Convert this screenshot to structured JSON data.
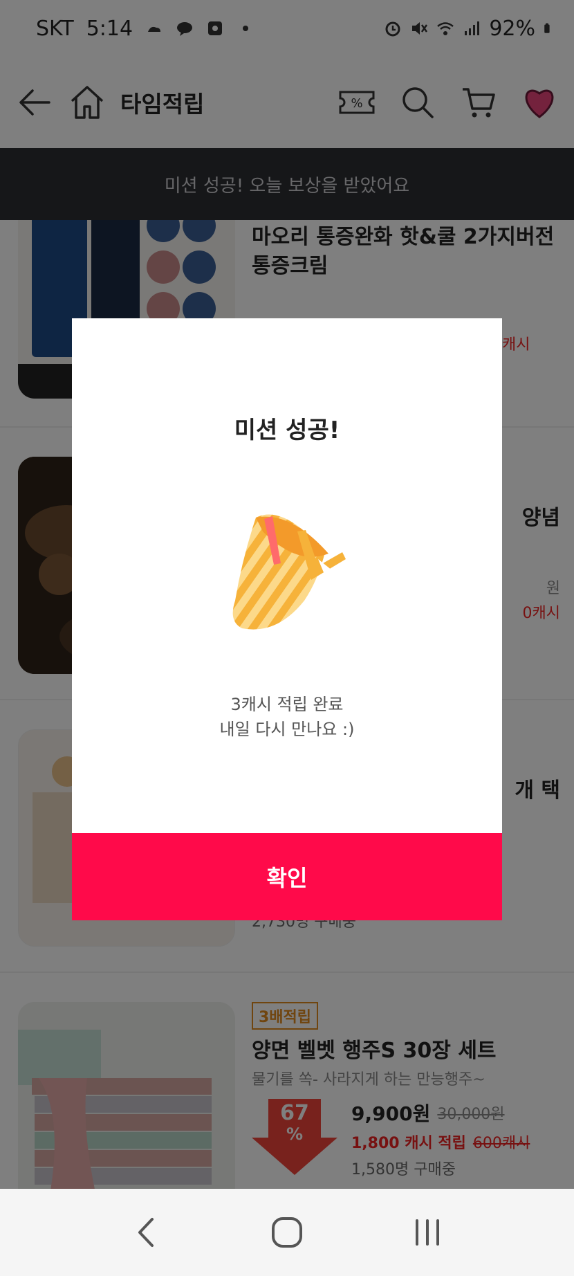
{
  "status_bar": {
    "carrier": "SKT",
    "time": "5:14",
    "battery": "92%"
  },
  "header": {
    "title": "타임적립"
  },
  "banner": {
    "text": "미션 성공! 오늘 보상을 받았어요"
  },
  "products": [
    {
      "title_line1": "마오리 통증완화 핫&쿨 2가지버전",
      "title_line2": "통증크림",
      "cash_suffix": "캐시"
    },
    {
      "title_partial": "양념",
      "price_suffix": "원",
      "cash_old": "0캐시"
    },
    {
      "title_partial": "개 택",
      "buyers": "2,730명 구매중"
    },
    {
      "tag": "3배적립",
      "title": "양면 벨벳 행주S 30장 세트",
      "subtitle": "물기를 쏙- 사라지게 하는 만능행주~",
      "discount": "67",
      "discount_unit": "%",
      "price": "9,900원",
      "old_price": "30,000원",
      "cash": "1,800 캐시 적립",
      "cash_old": "600캐시",
      "buyers": "1,580명 구매중"
    }
  ],
  "modal": {
    "title": "미션 성공!",
    "line1": "3캐시 적립 완료",
    "line2": "내일 다시 만나요 :)",
    "confirm": "확인"
  },
  "colors": {
    "accent": "#ff0a4a",
    "banner_bg": "#2d2e33",
    "tag": "#e08a1e"
  }
}
